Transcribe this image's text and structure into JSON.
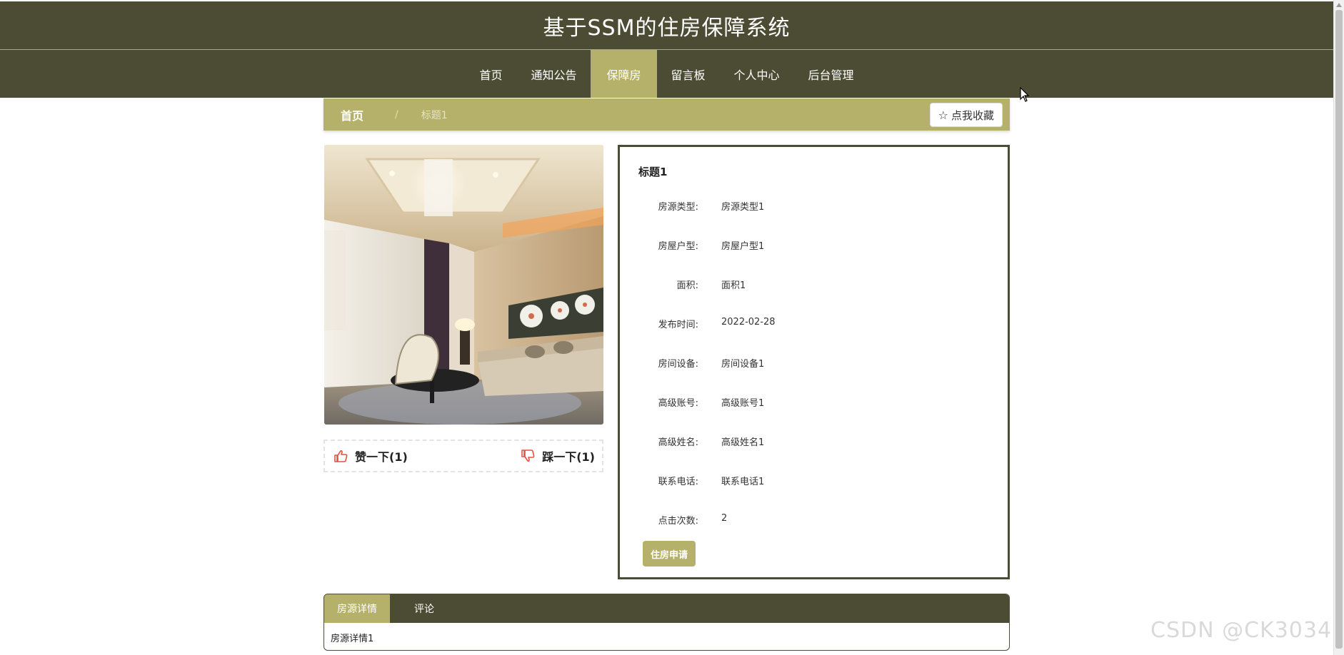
{
  "site": {
    "title": "基于SSM的住房保障系统"
  },
  "nav": {
    "items": [
      {
        "label": "首页",
        "active": false
      },
      {
        "label": "通知公告",
        "active": false
      },
      {
        "label": "保障房",
        "active": true
      },
      {
        "label": "留言板",
        "active": false
      },
      {
        "label": "个人中心",
        "active": false
      },
      {
        "label": "后台管理",
        "active": false
      }
    ]
  },
  "breadcrumb": {
    "home": "首页",
    "separator": "/",
    "current": "标题1"
  },
  "favorite": {
    "label": "点我收藏",
    "icon": "star-outline-icon"
  },
  "votes": {
    "like": {
      "label": "赞一下(1)",
      "icon": "thumbs-up-icon"
    },
    "dislike": {
      "label": "踩一下(1)",
      "icon": "thumbs-down-icon"
    }
  },
  "detail": {
    "title": "标题1",
    "fields": [
      {
        "label": "房源类型:",
        "value": "房源类型1"
      },
      {
        "label": "房屋户型:",
        "value": "房屋户型1"
      },
      {
        "label": "面积:",
        "value": "面积1"
      },
      {
        "label": "发布时间:",
        "value": "2022-02-28"
      },
      {
        "label": "房间设备:",
        "value": "房间设备1"
      },
      {
        "label": "高级账号:",
        "value": "高级账号1"
      },
      {
        "label": "高级姓名:",
        "value": "高级姓名1"
      },
      {
        "label": "联系电话:",
        "value": "联系电话1"
      },
      {
        "label": "点击次数:",
        "value": "2"
      }
    ],
    "apply_label": "住房申请"
  },
  "tabs": {
    "items": [
      {
        "label": "房源详情",
        "active": true
      },
      {
        "label": "评论",
        "active": false
      }
    ],
    "content": "房源详情1"
  },
  "watermark": "CSDN @CK3034",
  "colors": {
    "header": "#4c4c34",
    "accent": "#b5b06a",
    "like": "#e0533e"
  }
}
